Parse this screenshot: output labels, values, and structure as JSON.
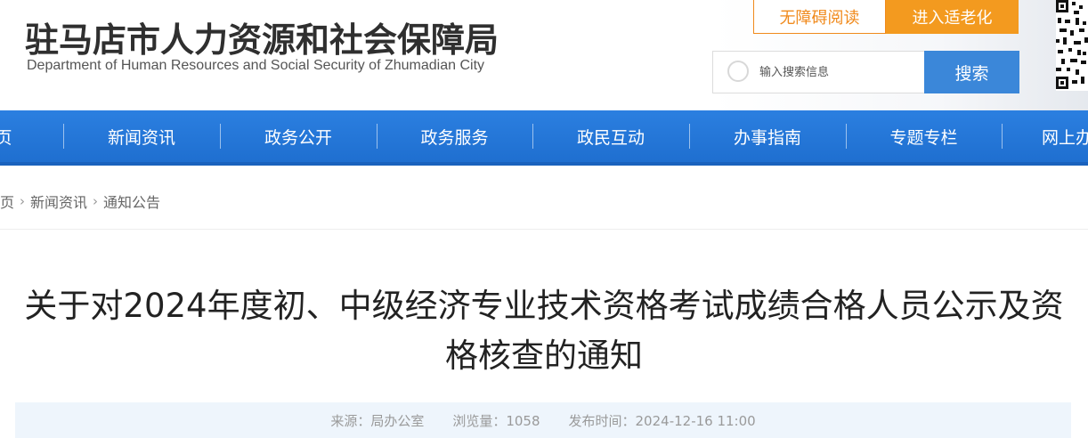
{
  "header": {
    "site_title": "驻马店市人力资源和社会保障局",
    "site_subtitle": "Department of Human Resources and Social Security of Zhumadian City",
    "accessible_label": "无障碍阅读",
    "elderly_label": "进入适老化",
    "search_placeholder": "输入搜索信息",
    "search_button_label": "搜索",
    "qr_icon": "qr-code-icon"
  },
  "nav": {
    "items": [
      "页",
      "新闻资讯",
      "政务公开",
      "政务服务",
      "政民互动",
      "办事指南",
      "专题专栏",
      "网上办"
    ]
  },
  "breadcrumb": {
    "items": [
      "页",
      "新闻资讯",
      "通知公告"
    ],
    "separator_icon": "chevron-right-icon"
  },
  "article": {
    "title": "关于对2024年度初、中级经济专业技术资格考试成绩合格人员公示及资格核查的通知",
    "source": "来源：局办公室",
    "views": "浏览量：1058",
    "published": "发布时间：2024-12-16 11:00"
  },
  "colors": {
    "nav_blue": "#2478dc",
    "accent_orange": "#f39a1f",
    "search_blue": "#3b87d9",
    "meta_bg": "#eef5fc"
  }
}
